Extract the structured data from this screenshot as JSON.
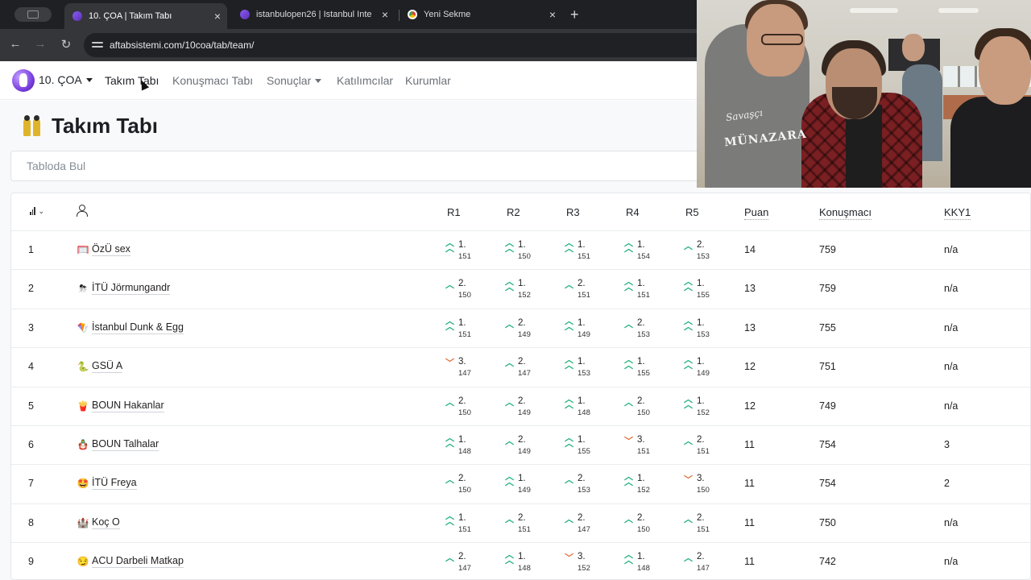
{
  "browser": {
    "tabs": [
      {
        "title": "10. ÇOA | Takım Tabı",
        "active": true,
        "favicon": "purple-logo-icon"
      },
      {
        "title": "istanbulopen26 | Istanbul Inte",
        "active": false,
        "favicon": "purple-logo-icon"
      },
      {
        "title": "Yeni Sekme",
        "active": false,
        "favicon": "chrome-icon"
      }
    ],
    "url": "aftabsistemi.com/10coa/tab/team/"
  },
  "nav": {
    "brand": "10. ÇOA",
    "links": [
      "Takım Tabı",
      "Konuşmacı Tabı",
      "Sonuçlar",
      "Katılımcılar",
      "Kurumlar"
    ]
  },
  "page": {
    "title": "Takım Tabı",
    "search_placeholder": "Tabloda Bul"
  },
  "table": {
    "headers": [
      "R1",
      "R2",
      "R3",
      "R4",
      "R5",
      "Puan",
      "Konuşmacı",
      "KKY1"
    ],
    "rows": [
      {
        "rank": "1",
        "emoji": "🥅",
        "team": "ÖzÜ sex",
        "rounds": [
          {
            "p": "1.",
            "s": "151",
            "t": "up2"
          },
          {
            "p": "1.",
            "s": "150",
            "t": "up2"
          },
          {
            "p": "1.",
            "s": "151",
            "t": "up2"
          },
          {
            "p": "1.",
            "s": "154",
            "t": "up2"
          },
          {
            "p": "2.",
            "s": "153",
            "t": "up1"
          }
        ],
        "points": "14",
        "speaker": "759",
        "kky": "n/a"
      },
      {
        "rank": "2",
        "emoji": "⛈",
        "team": "İTÜ Jörmungandr",
        "rounds": [
          {
            "p": "2.",
            "s": "150",
            "t": "up1"
          },
          {
            "p": "1.",
            "s": "152",
            "t": "up2"
          },
          {
            "p": "2.",
            "s": "151",
            "t": "up1"
          },
          {
            "p": "1.",
            "s": "151",
            "t": "up2"
          },
          {
            "p": "1.",
            "s": "155",
            "t": "up2"
          }
        ],
        "points": "13",
        "speaker": "759",
        "kky": "n/a"
      },
      {
        "rank": "3",
        "emoji": "🪁",
        "team": "İstanbul Dunk & Egg",
        "rounds": [
          {
            "p": "1.",
            "s": "151",
            "t": "up2"
          },
          {
            "p": "2.",
            "s": "149",
            "t": "up1"
          },
          {
            "p": "1.",
            "s": "149",
            "t": "up2"
          },
          {
            "p": "2.",
            "s": "153",
            "t": "up1"
          },
          {
            "p": "1.",
            "s": "153",
            "t": "up2"
          }
        ],
        "points": "13",
        "speaker": "755",
        "kky": "n/a"
      },
      {
        "rank": "4",
        "emoji": "🐍",
        "team": "GSÜ A",
        "rounds": [
          {
            "p": "3.",
            "s": "147",
            "t": "dn1"
          },
          {
            "p": "2.",
            "s": "147",
            "t": "up1"
          },
          {
            "p": "1.",
            "s": "153",
            "t": "up2"
          },
          {
            "p": "1.",
            "s": "155",
            "t": "up2"
          },
          {
            "p": "1.",
            "s": "149",
            "t": "up2"
          }
        ],
        "points": "12",
        "speaker": "751",
        "kky": "n/a"
      },
      {
        "rank": "5",
        "emoji": "🍟",
        "team": "BOUN Hakanlar",
        "rounds": [
          {
            "p": "2.",
            "s": "150",
            "t": "up1"
          },
          {
            "p": "2.",
            "s": "149",
            "t": "up1"
          },
          {
            "p": "1.",
            "s": "148",
            "t": "up2"
          },
          {
            "p": "2.",
            "s": "150",
            "t": "up1"
          },
          {
            "p": "1.",
            "s": "152",
            "t": "up2"
          }
        ],
        "points": "12",
        "speaker": "749",
        "kky": "n/a"
      },
      {
        "rank": "6",
        "emoji": "🪆",
        "team": "BOUN Talhalar",
        "rounds": [
          {
            "p": "1.",
            "s": "148",
            "t": "up2"
          },
          {
            "p": "2.",
            "s": "149",
            "t": "up1"
          },
          {
            "p": "1.",
            "s": "155",
            "t": "up2"
          },
          {
            "p": "3.",
            "s": "151",
            "t": "dn1"
          },
          {
            "p": "2.",
            "s": "151",
            "t": "up1"
          }
        ],
        "points": "11",
        "speaker": "754",
        "kky": "3"
      },
      {
        "rank": "7",
        "emoji": "🤩",
        "team": "İTÜ Freya",
        "rounds": [
          {
            "p": "2.",
            "s": "150",
            "t": "up1"
          },
          {
            "p": "1.",
            "s": "149",
            "t": "up2"
          },
          {
            "p": "2.",
            "s": "153",
            "t": "up1"
          },
          {
            "p": "1.",
            "s": "152",
            "t": "up2"
          },
          {
            "p": "3.",
            "s": "150",
            "t": "dn1"
          }
        ],
        "points": "11",
        "speaker": "754",
        "kky": "2"
      },
      {
        "rank": "8",
        "emoji": "🏰",
        "team": "Koç O",
        "rounds": [
          {
            "p": "1.",
            "s": "151",
            "t": "up2"
          },
          {
            "p": "2.",
            "s": "151",
            "t": "up1"
          },
          {
            "p": "2.",
            "s": "147",
            "t": "up1"
          },
          {
            "p": "2.",
            "s": "150",
            "t": "up1"
          },
          {
            "p": "2.",
            "s": "151",
            "t": "up1"
          }
        ],
        "points": "11",
        "speaker": "750",
        "kky": "n/a"
      },
      {
        "rank": "9",
        "emoji": "😏",
        "team": "ACU Darbeli Matkap",
        "rounds": [
          {
            "p": "2.",
            "s": "147",
            "t": "up1"
          },
          {
            "p": "1.",
            "s": "148",
            "t": "up2"
          },
          {
            "p": "3.",
            "s": "152",
            "t": "dn1"
          },
          {
            "p": "1.",
            "s": "148",
            "t": "up2"
          },
          {
            "p": "2.",
            "s": "147",
            "t": "up1"
          }
        ],
        "points": "11",
        "speaker": "742",
        "kky": "n/a"
      }
    ]
  },
  "webcam": {
    "hoodie_text_1": "Savaşçı",
    "hoodie_text_2": "MÜNAZARA"
  }
}
